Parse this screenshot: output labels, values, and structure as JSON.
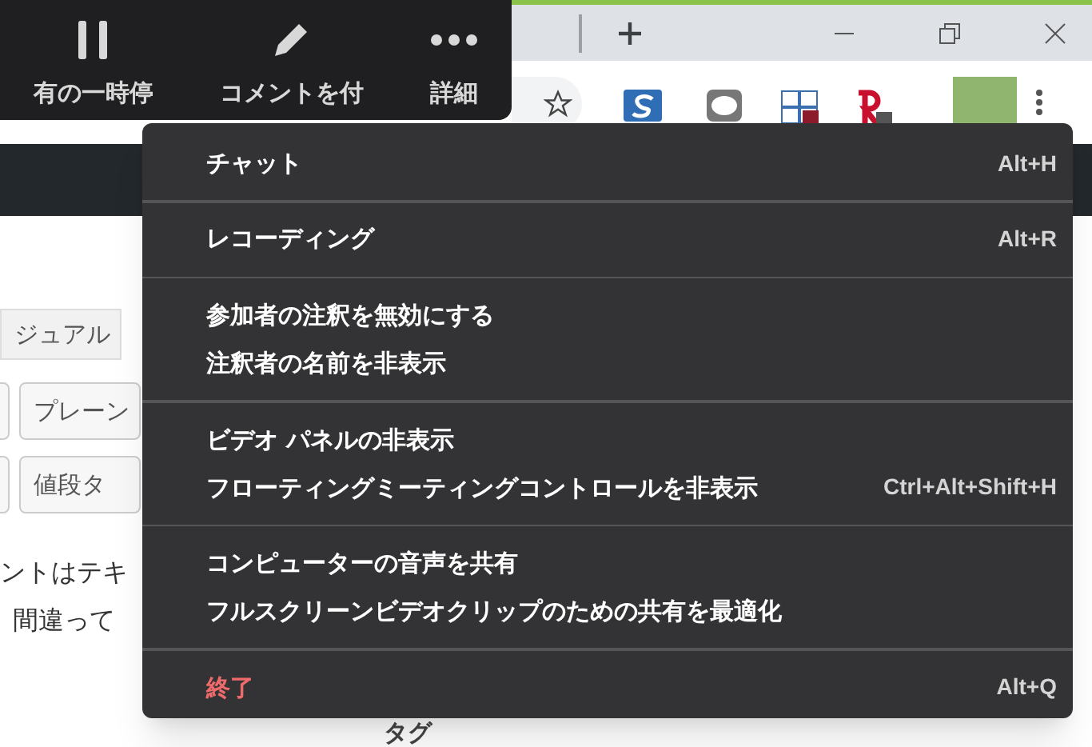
{
  "meeting_toolbar": {
    "buttons": [
      {
        "kind": "pause",
        "label": "有の一時停"
      },
      {
        "kind": "pencil",
        "label": "コメントを付"
      },
      {
        "kind": "dots",
        "label": "詳細"
      }
    ]
  },
  "page": {
    "tab": "ジュアル",
    "tag_buttons": [
      "プレーン",
      "値段タ"
    ],
    "lines": [
      "ントはテキ",
      "間違って"
    ],
    "footer_label": "タグ"
  },
  "menu": {
    "groups": [
      {
        "items": [
          {
            "label": "チャット",
            "shortcut": "Alt+H",
            "kind": "normal"
          }
        ]
      },
      {
        "items": [
          {
            "label": "レコーディング",
            "shortcut": "Alt+R",
            "kind": "normal"
          }
        ]
      },
      {
        "items": [
          {
            "label": "参加者の注釈を無効にする",
            "kind": "normal"
          },
          {
            "label": "注釈者の名前を非表示",
            "kind": "normal"
          }
        ]
      },
      {
        "items": [
          {
            "label": "ビデオ パネルの非表示",
            "kind": "normal"
          },
          {
            "label": "フローティングミーティングコントロールを非表示",
            "shortcut": "Ctrl+Alt+Shift+H",
            "kind": "normal"
          }
        ]
      },
      {
        "items": [
          {
            "label": "コンピューターの音声を共有",
            "kind": "normal"
          },
          {
            "label": "フルスクリーンビデオクリップのための共有を最適化",
            "kind": "normal"
          }
        ]
      },
      {
        "items": [
          {
            "label": "終了",
            "shortcut": "Alt+Q",
            "kind": "danger"
          }
        ]
      }
    ]
  }
}
